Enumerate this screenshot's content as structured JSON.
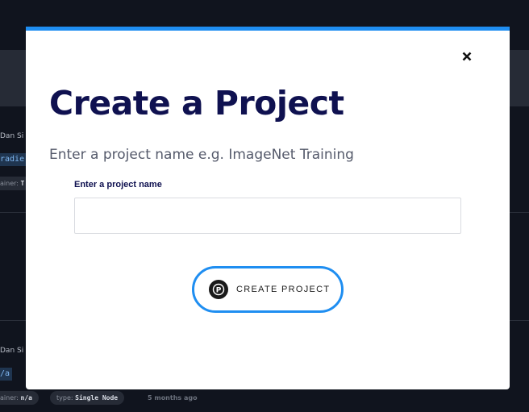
{
  "background": {
    "item1": {
      "author": "Dan Si",
      "code": "radie",
      "container_key": "ainer:",
      "container_value": "T"
    },
    "item2": {
      "author": "Dan Si",
      "code": "/a",
      "container_key": "ainer:",
      "container_value": "n/a",
      "type_key": "type:",
      "type_value": "Single Node",
      "time": "5 months ago"
    }
  },
  "modal": {
    "title": "Create a Project",
    "subtitle": "Enter a project name e.g. ImageNet Training",
    "field_label": "Enter a project name",
    "field_value": "",
    "field_placeholder": "",
    "button_label": "CREATE PROJECT",
    "button_logo_letter": "P",
    "close_icon": "close-icon"
  },
  "colors": {
    "accent": "#1f8ef1",
    "title": "#0f1150",
    "backdrop": "#10141e"
  }
}
